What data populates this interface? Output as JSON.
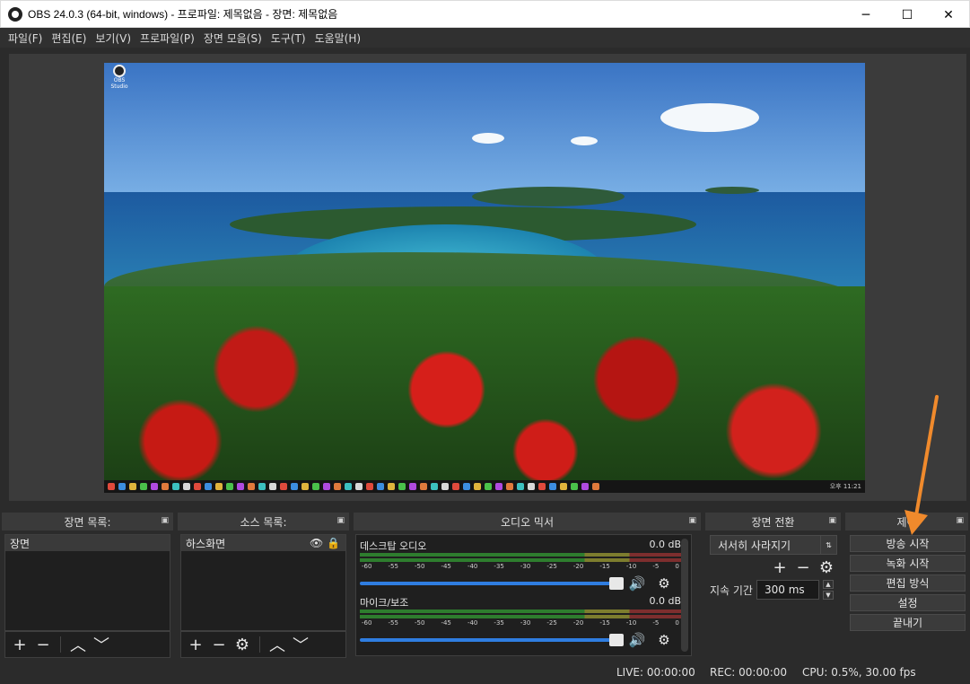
{
  "window": {
    "title": "OBS 24.0.3 (64-bit, windows) - 프로파일: 제목없음 - 장면: 제목없음",
    "minimize": "─",
    "maximize": "☐",
    "close": "✕"
  },
  "menu": [
    "파일(F)",
    "편집(E)",
    "보기(V)",
    "프로파일(P)",
    "장면 모음(S)",
    "도구(T)",
    "도움말(H)"
  ],
  "preview": {
    "desktop_icon_label": "OBS Studio",
    "taskbar_clock": "오후 11:21"
  },
  "scenes": {
    "title": "장면 목록:",
    "items": [
      "장면"
    ]
  },
  "sources": {
    "title": "소스 목록:",
    "items": [
      "하스화면"
    ]
  },
  "mixer": {
    "title": "오디오 믹서",
    "tracks": [
      {
        "name": "데스크탑 오디오",
        "level": "0.0 dB"
      },
      {
        "name": "마이크/보조",
        "level": "0.0 dB"
      }
    ],
    "ticks": [
      "-60",
      "-55",
      "-50",
      "-45",
      "-40",
      "-35",
      "-30",
      "-25",
      "-20",
      "-15",
      "-10",
      "-5",
      "0"
    ]
  },
  "transitions": {
    "title": "장면 전환",
    "selected": "서서히 사라지기",
    "duration_label": "지속 기간",
    "duration_value": "300 ms"
  },
  "controls": {
    "title": "제어",
    "buttons": [
      "방송 시작",
      "녹화 시작",
      "편집 방식",
      "설정",
      "끝내기"
    ]
  },
  "status": {
    "live": "LIVE: 00:00:00",
    "rec": "REC: 00:00:00",
    "cpu": "CPU: 0.5%, 30.00 fps"
  },
  "icons": {
    "undock": "undock-icon",
    "add": "plus-icon",
    "remove": "minus-icon",
    "up": "chevron-up-icon",
    "down": "chevron-down-icon",
    "gear": "gear-icon",
    "eye": "eye-icon",
    "lock": "lock-icon",
    "speaker": "speaker-icon"
  },
  "colors": {
    "annotation_arrow": "#f08a2c",
    "fader": "#2f7de0"
  }
}
